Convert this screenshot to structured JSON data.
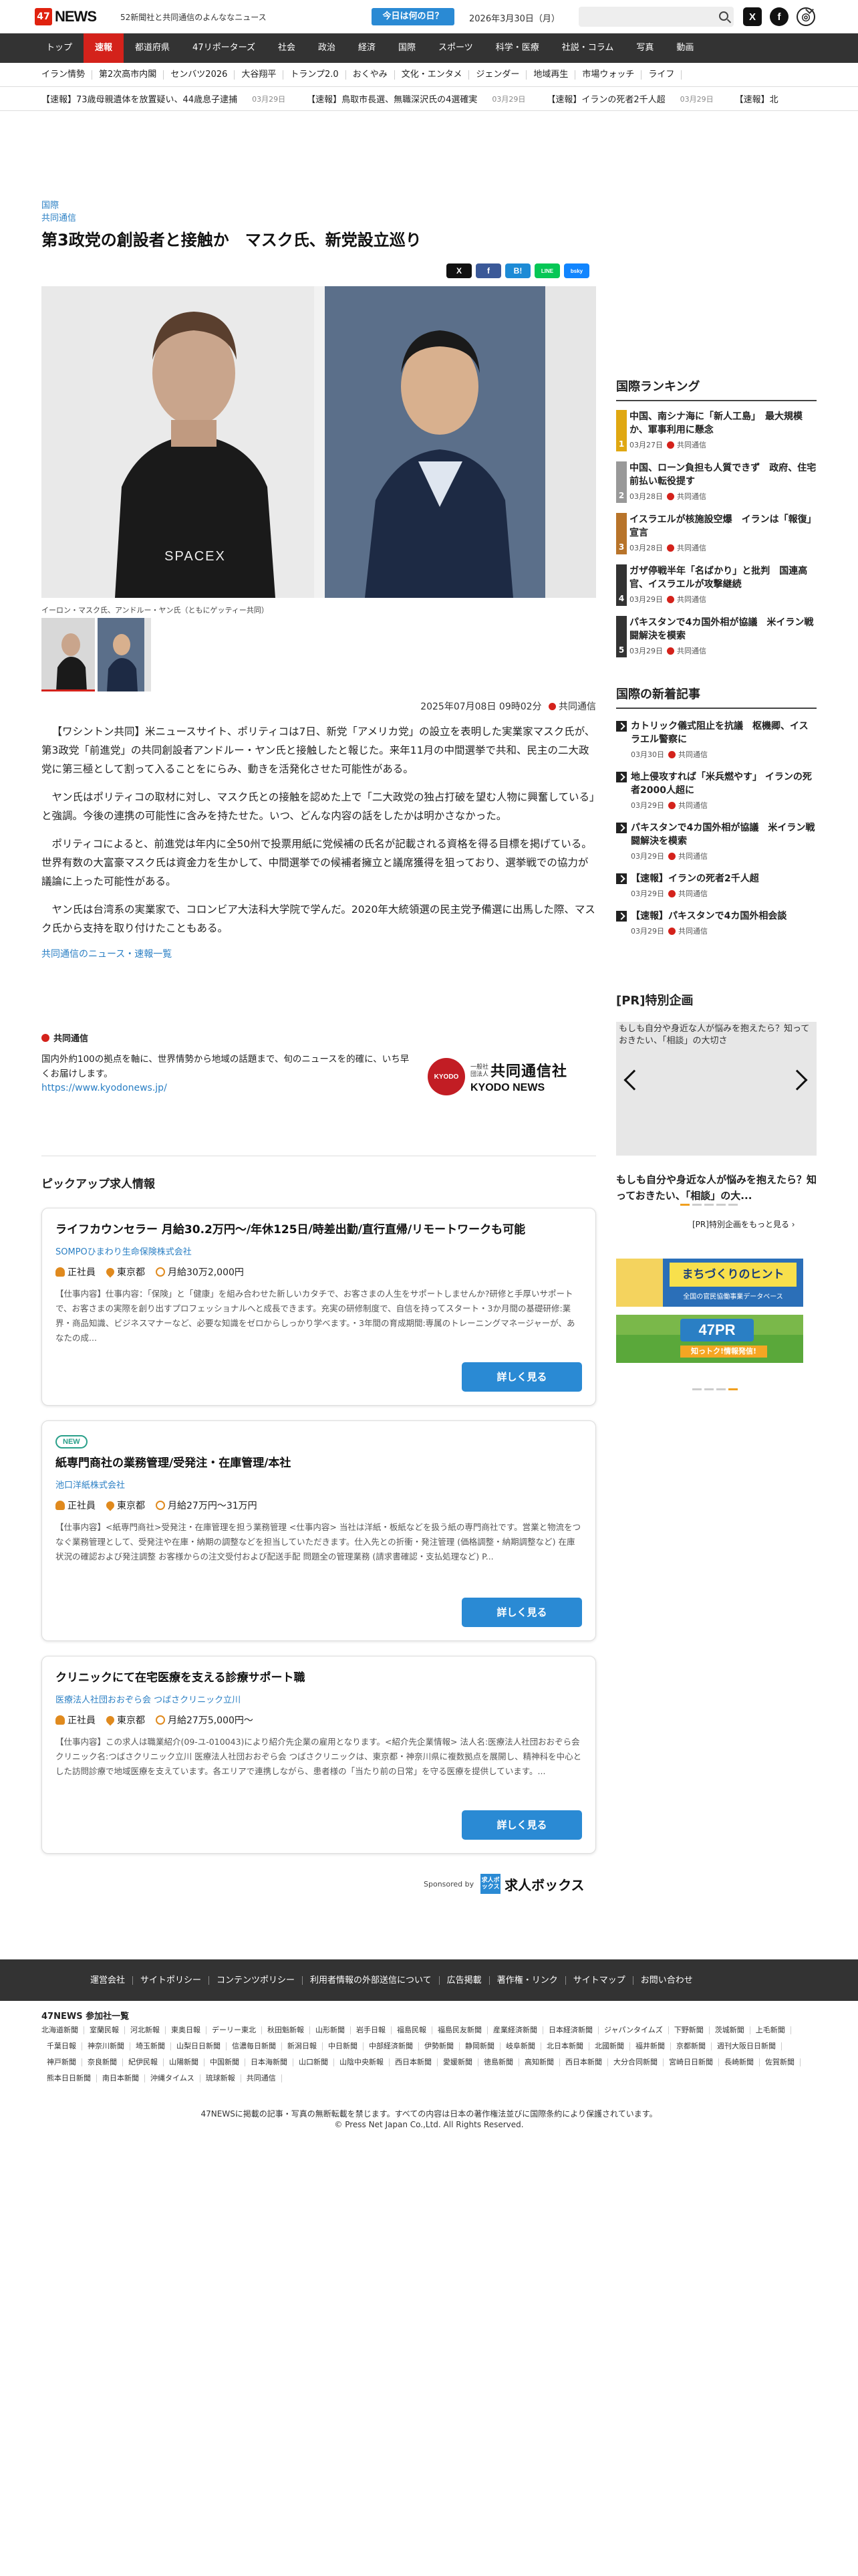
{
  "header": {
    "logo_text": "NEWS",
    "logo_num": "47",
    "tagline": "52新聞社と共同通信のよんななニュース",
    "today_button": "今日は何の日？",
    "date": "2026年3月30日（月）",
    "social": [
      "X",
      "f",
      "globe"
    ]
  },
  "nav": {
    "items": [
      "トップ",
      "速報",
      "都道府県",
      "47リポーターズ",
      "社会",
      "政治",
      "経済",
      "国際",
      "スポーツ",
      "科学・医療",
      "社説・コラム",
      "写真",
      "動画"
    ],
    "active_index": 1
  },
  "subnav": {
    "items": [
      "イラン情勢",
      "第2次高市内閣",
      "センバツ2026",
      "大谷翔平",
      "トランプ2.0",
      "おくやみ",
      "文化・エンタメ",
      "ジェンダー",
      "地域再生",
      "市場ウォッチ",
      "ライフ"
    ]
  },
  "ticker": [
    {
      "text": "【速報】73歳母親遺体を放置疑い、44歳息子逮捕",
      "date": "03月29日"
    },
    {
      "text": "【速報】鳥取市長選、無職深沢氏の4選確実",
      "date": "03月29日"
    },
    {
      "text": "【速報】イランの死者2千人超",
      "date": "03月29日"
    },
    {
      "text": "【速報】北",
      "date": ""
    }
  ],
  "article": {
    "category": "国際",
    "source": "共同通信",
    "title": "第3政党の創設者と接触か　マスク氏、新党設立巡り",
    "share_buttons": [
      "X",
      "f",
      "B!",
      "LINE",
      "bsky"
    ],
    "photo_caption": "イーロン・マスク氏、アンドルー・ヤン氏（ともにゲッティー共同）",
    "timestamp": "2025年07月08日 09時02分",
    "publisher": "共同通信",
    "paragraphs": [
      "【ワシントン共同】米ニュースサイト、ポリティコは7日、新党「アメリカ党」の設立を表明した実業家マスク氏が、第3政党「前進党」の共同創設者アンドルー・ヤン氏と接触したと報じた。来年11月の中間選挙で共和、民主の二大政党に第三極として割って入ることをにらみ、動きを活発化させた可能性がある。",
      "ヤン氏はポリティコの取材に対し、マスク氏との接触を認めた上で「二大政党の独占打破を望む人物に興奮している」と強調。今後の連携の可能性に含みを持たせた。いつ、どんな内容の話をしたかは明かさなかった。",
      "ポリティコによると、前進党は年内に全50州で投票用紙に党候補の氏名が記載される資格を得る目標を掲げている。世界有数の大富豪マスク氏は資金力を生かして、中間選挙での候補者擁立と議席獲得を狙っており、選挙戦での協力が議論に上った可能性がある。",
      "ヤン氏は台湾系の実業家で、コロンビア大法科大学院で学んだ。2020年大統領選の民主党予備選に出馬した際、マスク氏から支持を取り付けたこともある。"
    ],
    "more_link": "共同通信のニュース・速報一覧"
  },
  "kyodo": {
    "name": "共同通信",
    "description": "国内外約100の拠点を軸に、世界情勢から地域の話題まで、旬のニュースを的確に、いち早くお届けします。",
    "url": "https://www.kyodonews.jp/",
    "logo_small": "一般社団法人",
    "logo_big": "共同通信社",
    "logo_en": "KYODO NEWS"
  },
  "jobs": {
    "section_title": "ピックアップ求人情報",
    "items": [
      {
        "is_new": false,
        "title": "ライフカウンセラー 月給30.2万円〜/年休125日/時差出勤/直行直帰/リモートワークも可能",
        "company": "SOMPOひまわり生命保険株式会社",
        "employment": "正社員",
        "location": "東京都",
        "salary": "月給30万2,000円",
        "description": "【仕事内容】仕事内容：「保険」と「健康」を組み合わせた新しいカタチで、お客さまの人生をサポートしませんか?研修と手厚いサポートで、お客さまの実際を創り出すプロフェッショナルへと成長できます。充実の研修制度で、自信を持ってスタート・3か月間の基礎研修:業界・商品知識、ビジネスマナーなど、必要な知識をゼロからしっかり学べます。・3年間の育成期間:専属のトレーニングマネージャーが、あなたの成...",
        "button": "詳しく見る"
      },
      {
        "is_new": true,
        "new_label": "NEW",
        "title": "紙専門商社の業務管理/受発注・在庫管理/本社",
        "company": "池口洋紙株式会社",
        "employment": "正社員",
        "location": "東京都",
        "salary": "月給27万円〜31万円",
        "description": "【仕事内容】<紙専門商社>受発注・在庫管理を担う業務管理 <仕事内容> 当社は洋紙・板紙などを扱う紙の専門商社です。営業と物流をつなぐ業務管理として、受発注や在庫・納期の調整などを担当していただきます。仕入先との折衝・発注管理 (価格調整・納期調整など) 在庫状況の確認および発注調整 お客様からの注文受付および配送手配 問題全の管理業務 (請求書確認・支払処理など) P...",
        "button": "詳しく見る"
      },
      {
        "is_new": false,
        "title": "クリニックにて在宅医療を支える診療サポート職",
        "company": "医療法人社団おおぞら会 つばさクリニック立川",
        "employment": "正社員",
        "location": "東京都",
        "salary": "月給27万5,000円〜",
        "description": "【仕事内容】この求人は職業紹介(09-ユ-010043)により紹介先企業の雇用となります。<紹介先企業情報> 法人名:医療法人社団おおぞら会 クリニック名:つばさクリニック立川 医療法人社団おおぞら会 つばさクリニックは、東京都・神奈川県に複数拠点を展開し、精神科を中心とした訪問診療で地域医療を支えています。各エリアで連携しながら、患者様の「当たり前の日常」を守る医療を提供しています。...",
        "button": "詳しく見る"
      }
    ],
    "sponsor_label": "Sponsored by",
    "sponsor_icon": "求人ボックス",
    "sponsor_name": "求人ボックス"
  },
  "sidebar": {
    "ranking_title": "国際ランキング",
    "ranking": [
      {
        "rank": "1",
        "color": "#e0a812",
        "title": "中国、南シナ海に「新人工島」　最大規模か、軍事利用に懸念",
        "date": "03月27日",
        "source": "共同通信"
      },
      {
        "rank": "2",
        "color": "#999999",
        "title": "中国、ローン負担も人質できず　政府、住宅前払い転役提す",
        "date": "03月28日",
        "source": "共同通信"
      },
      {
        "rank": "3",
        "color": "#b8742a",
        "title": "イスラエルが核施設空爆　イランは「報復」宣言",
        "date": "03月28日",
        "source": "共同通信"
      },
      {
        "rank": "4",
        "color": "#333333",
        "title": "ガザ停戦半年「名ばかり」と批判　国連高官、イスラエルが攻撃継続",
        "date": "03月29日",
        "source": "共同通信"
      },
      {
        "rank": "5",
        "color": "#333333",
        "title": "パキスタンで4カ国外相が協議　米イラン戦闘解決を模索",
        "date": "03月29日",
        "source": "共同通信"
      }
    ],
    "new_title": "国際の新着記事",
    "new_items": [
      {
        "title": "カトリック儀式阻止を抗議　枢機卿、イスラエル警察に",
        "date": "03月30日",
        "source": "共同通信"
      },
      {
        "title": "地上侵攻すれば「米兵燃やす」 イランの死者2000人超に",
        "date": "03月29日",
        "source": "共同通信"
      },
      {
        "title": "パキスタンで4カ国外相が協議　米イラン戦闘解決を模索",
        "date": "03月29日",
        "source": "共同通信"
      },
      {
        "title": "【速報】イランの死者2千人超",
        "date": "03月29日",
        "source": "共同通信"
      },
      {
        "title": "【速報】パキスタンで4カ国外相会談",
        "date": "03月29日",
        "source": "共同通信"
      }
    ],
    "pr_title": "[PR]特別企画",
    "pr_image_text": "もしも自分や身近な人が悩みを抱えたら？知っておきたい、「相談」の大切さ",
    "pr_caption": "もしも自分や身近な人が悩みを抱えたら？知っておきたい、「相談」の大...",
    "pr_list_link": "[PR]特別企画をもっと見る ›",
    "banner1_title": "まちづくりのヒント",
    "banner1_sub": "全国の官民協働事業データベース",
    "banner2_title": "47PR",
    "banner2_sub": "知っトク!情報発信!"
  },
  "footer": {
    "links": [
      "運営会社",
      "サイトポリシー",
      "コンテンツポリシー",
      "利用者情報の外部送信について",
      "広告掲載",
      "著作権・リンク",
      "サイトマップ",
      "お問い合わせ"
    ],
    "members_title": "47NEWS 参加社一覧",
    "members": [
      "北海道新聞",
      "室蘭民報",
      "河北新報",
      "東奥日報",
      "デーリー東北",
      "秋田魁新報",
      "山形新聞",
      "岩手日報",
      "福島民報",
      "福島民友新聞",
      "産業経済新聞",
      "日本経済新聞",
      "ジャパンタイムズ",
      "下野新聞",
      "茨城新聞",
      "上毛新聞",
      "千葉日報",
      "神奈川新聞",
      "埼玉新聞",
      "山梨日日新聞",
      "信濃毎日新聞",
      "新潟日報",
      "中日新聞",
      "中部経済新聞",
      "伊勢新聞",
      "静岡新聞",
      "岐阜新聞",
      "北日本新聞",
      "北國新聞",
      "福井新聞",
      "京都新聞",
      "週刊大阪日日新聞",
      "神戸新聞",
      "奈良新聞",
      "紀伊民報",
      "山陽新聞",
      "中国新聞",
      "日本海新聞",
      "山口新聞",
      "山陰中央新報",
      "西日本新聞",
      "愛媛新聞",
      "徳島新聞",
      "高知新聞",
      "西日本新聞",
      "大分合同新聞",
      "宮崎日日新聞",
      "長崎新聞",
      "佐賀新聞",
      "熊本日日新聞",
      "南日本新聞",
      "沖縄タイムス",
      "琉球新報",
      "共同通信"
    ],
    "copyright1": "47NEWSに掲載の記事・写真の無断転載を禁じます。すべての内容は日本の著作権法並びに国際条約により保護されています。",
    "copyright2": "© Press Net Japan Co.,Ltd. All Rights Reserved."
  }
}
